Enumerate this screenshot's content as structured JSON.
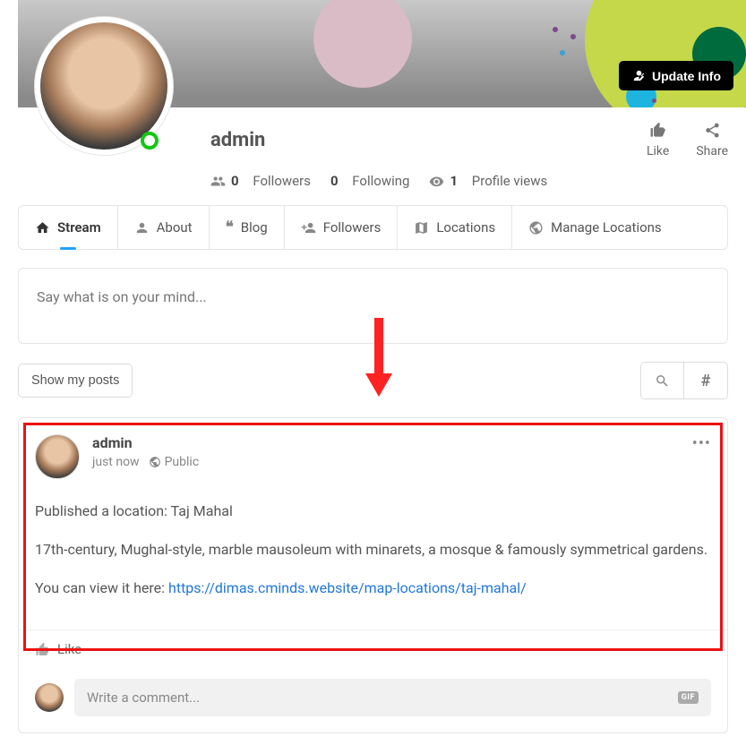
{
  "coverButton": "Update Info",
  "profile": {
    "name": "admin",
    "stats": {
      "followersCount": "0",
      "followersLabel": "Followers",
      "followingCount": "0",
      "followingLabel": "Following",
      "viewsCount": "1",
      "viewsLabel": "Profile views"
    }
  },
  "actions": {
    "like": "Like",
    "share": "Share"
  },
  "tabs": {
    "stream": "Stream",
    "about": "About",
    "blog": "Blog",
    "followers": "Followers",
    "locations": "Locations",
    "manage": "Manage Locations"
  },
  "composer": {
    "placeholder": "Say what is on your mind..."
  },
  "filters": {
    "showMy": "Show my posts"
  },
  "post": {
    "author": "admin",
    "time": "just now",
    "privacy": "Public",
    "line1": "Published a location: Taj Mahal",
    "line2": "17th-century, Mughal-style, marble mausoleum with minarets, a mosque & famously symmetrical gardens.",
    "line3pre": "You can view it here: ",
    "link": "https://dimas.cminds.website/map-locations/taj-mahal/",
    "like": "Like"
  },
  "comment": {
    "placeholder": "Write a comment...",
    "gif": "GIF"
  }
}
